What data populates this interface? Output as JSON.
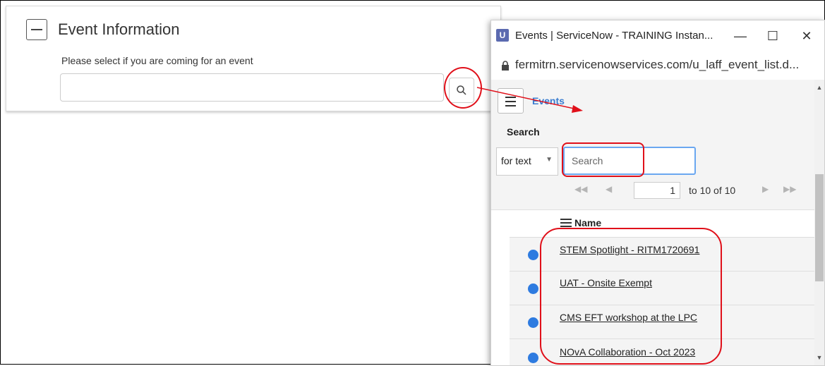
{
  "form": {
    "title": "Event Information",
    "field_label": "Please select if you are coming for an event",
    "field_value": ""
  },
  "popup": {
    "window_title": "Events | ServiceNow - TRAINING Instan...",
    "url": "fermitrn.servicenowservices.com/u_laff_event_list.d...",
    "list_title": "Events",
    "search_label": "Search",
    "search_field_selector": "for text",
    "search_placeholder": "Search",
    "page_number": "1",
    "page_range": "to 10 of 10",
    "column_name": "Name",
    "rows": [
      "STEM Spotlight - RITM1720691",
      "UAT - Onsite Exempt",
      "CMS EFT workshop at the LPC",
      "NOvA Collaboration - Oct 2023"
    ]
  },
  "colors": {
    "annotation": "#e0101a",
    "link_blue": "#3a7dd0",
    "dot_blue": "#2e7be0",
    "focus_blue": "#6aa7f0"
  },
  "icons": {
    "collapse": "minus-box-icon",
    "lookup": "magnifier-icon",
    "app": "servicenow-icon",
    "lock": "lock-icon",
    "menu": "hamburger-icon"
  }
}
